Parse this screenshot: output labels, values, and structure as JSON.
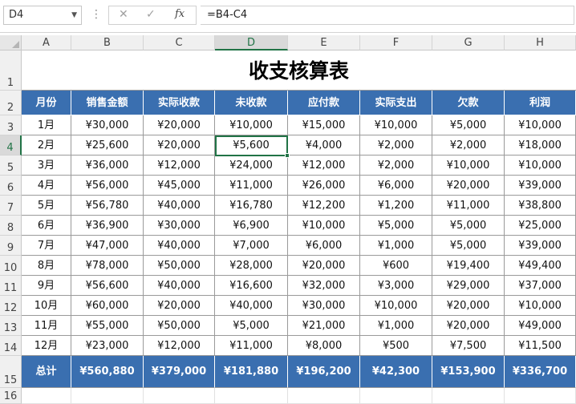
{
  "formula_bar": {
    "name_box": "D4",
    "cancel_glyph": "✕",
    "enter_glyph": "✓",
    "fx_label": "fx",
    "formula": "=B4-C4"
  },
  "sheet": {
    "selected_cell": "D4",
    "column_headers": [
      "A",
      "B",
      "C",
      "D",
      "E",
      "F",
      "G",
      "H"
    ],
    "row_headers": [
      "1",
      "2",
      "3",
      "4",
      "5",
      "6",
      "7",
      "8",
      "9",
      "10",
      "11",
      "12",
      "13",
      "14",
      "15",
      "16"
    ],
    "title": "收支核算表",
    "table_headers": [
      "月份",
      "销售金额",
      "实际收款",
      "未收款",
      "应付款",
      "实际支出",
      "欠款",
      "利润"
    ],
    "rows": [
      [
        "1月",
        "¥30,000",
        "¥20,000",
        "¥10,000",
        "¥15,000",
        "¥10,000",
        "¥5,000",
        "¥10,000"
      ],
      [
        "2月",
        "¥25,600",
        "¥20,000",
        "¥5,600",
        "¥4,000",
        "¥2,000",
        "¥2,000",
        "¥18,000"
      ],
      [
        "3月",
        "¥36,000",
        "¥12,000",
        "¥24,000",
        "¥12,000",
        "¥2,000",
        "¥10,000",
        "¥10,000"
      ],
      [
        "4月",
        "¥56,000",
        "¥45,000",
        "¥11,000",
        "¥26,000",
        "¥6,000",
        "¥20,000",
        "¥39,000"
      ],
      [
        "5月",
        "¥56,780",
        "¥40,000",
        "¥16,780",
        "¥12,200",
        "¥1,200",
        "¥11,000",
        "¥38,800"
      ],
      [
        "6月",
        "¥36,900",
        "¥30,000",
        "¥6,900",
        "¥10,000",
        "¥5,000",
        "¥5,000",
        "¥25,000"
      ],
      [
        "7月",
        "¥47,000",
        "¥40,000",
        "¥7,000",
        "¥6,000",
        "¥1,000",
        "¥5,000",
        "¥39,000"
      ],
      [
        "8月",
        "¥78,000",
        "¥50,000",
        "¥28,000",
        "¥20,000",
        "¥600",
        "¥19,400",
        "¥49,400"
      ],
      [
        "9月",
        "¥56,600",
        "¥40,000",
        "¥16,600",
        "¥32,000",
        "¥3,000",
        "¥29,000",
        "¥37,000"
      ],
      [
        "10月",
        "¥60,000",
        "¥20,000",
        "¥40,000",
        "¥30,000",
        "¥10,000",
        "¥20,000",
        "¥10,000"
      ],
      [
        "11月",
        "¥55,000",
        "¥50,000",
        "¥5,000",
        "¥21,000",
        "¥1,000",
        "¥20,000",
        "¥49,000"
      ],
      [
        "12月",
        "¥23,000",
        "¥12,000",
        "¥11,000",
        "¥8,000",
        "¥500",
        "¥7,500",
        "¥11,500"
      ]
    ],
    "total_row": [
      "总计",
      "¥560,880",
      "¥379,000",
      "¥181,880",
      "¥196,200",
      "¥42,300",
      "¥153,900",
      "¥336,700"
    ]
  },
  "colors": {
    "header_fill": "#3a6fb0",
    "selection": "#217346"
  }
}
